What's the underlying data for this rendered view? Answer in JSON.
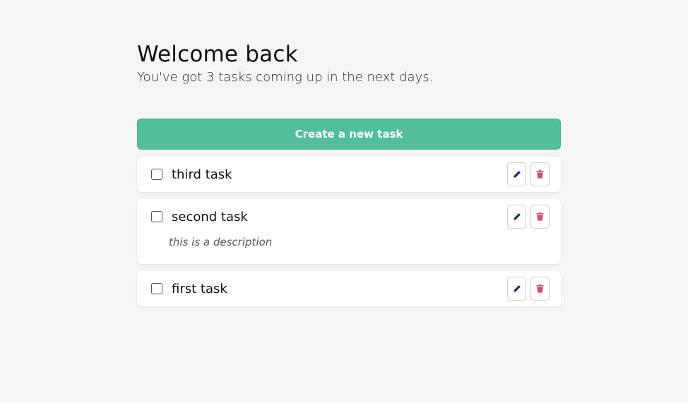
{
  "header": {
    "title": "Welcome back",
    "subtitle": "You've got 3 tasks coming up in the next days."
  },
  "create_button": {
    "label": "Create a new task",
    "color": "#52bf9c"
  },
  "colors": {
    "edit_icon": "#12305e",
    "delete_icon": "#d14f78"
  },
  "tasks": [
    {
      "title": "third task",
      "description": "",
      "done": false
    },
    {
      "title": "second task",
      "description": "this is a description",
      "done": false
    },
    {
      "title": "first task",
      "description": "",
      "done": false
    }
  ],
  "icons": {
    "edit": "pencil-icon",
    "delete": "trash-icon"
  }
}
